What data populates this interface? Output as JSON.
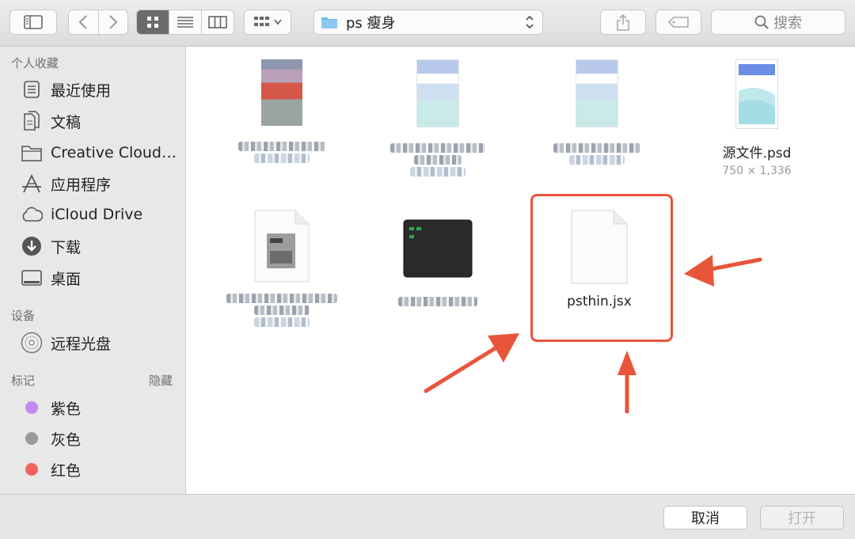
{
  "toolbar": {
    "path_label": "ps 瘦身",
    "search_placeholder": "搜索"
  },
  "sidebar": {
    "favorites_header": "个人收藏",
    "favorites": [
      {
        "label": "最近使用",
        "icon": "recents-icon"
      },
      {
        "label": "文稿",
        "icon": "documents-icon"
      },
      {
        "label": "Creative Cloud…",
        "icon": "folder-icon"
      },
      {
        "label": "应用程序",
        "icon": "applications-icon"
      },
      {
        "label": "iCloud Drive",
        "icon": "cloud-icon"
      },
      {
        "label": "下载",
        "icon": "download-icon"
      },
      {
        "label": "桌面",
        "icon": "desktop-icon"
      }
    ],
    "devices_header": "设备",
    "devices": [
      {
        "label": "远程光盘",
        "icon": "disc-icon"
      }
    ],
    "tags_header": "标记",
    "tags_hide": "隐藏",
    "tags": [
      {
        "label": "紫色",
        "color": "#c58af0"
      },
      {
        "label": "灰色",
        "color": "#9a9a9a"
      },
      {
        "label": "红色",
        "color": "#f0625a"
      }
    ]
  },
  "files": {
    "psd": {
      "name": "源文件.psd",
      "meta": "750 × 1,336"
    },
    "jsx": {
      "name": "psthin.jsx"
    }
  },
  "bottom": {
    "cancel": "取消",
    "open": "打开"
  },
  "colors": {
    "highlight": "#e8553a",
    "toolbar_active": "#6b6b6b",
    "folder_blue": "#6cb8ec"
  }
}
